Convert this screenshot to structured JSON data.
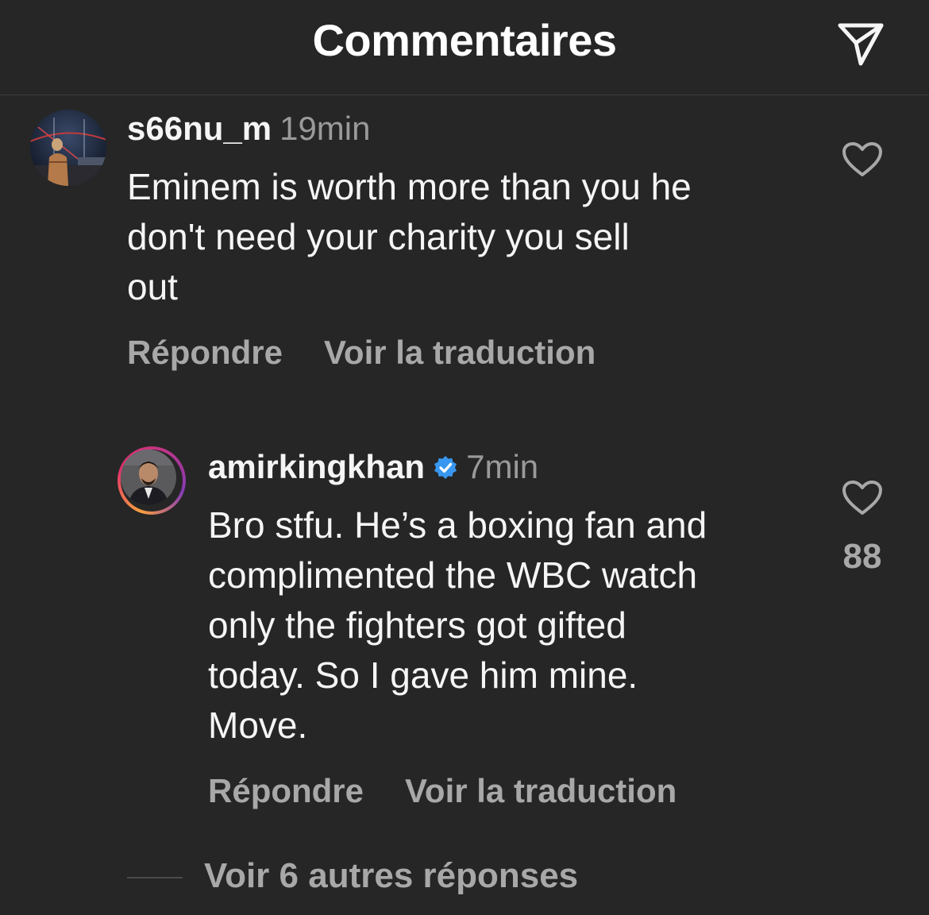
{
  "header": {
    "title": "Commentaires",
    "share_icon": "paper-plane-icon"
  },
  "comments": [
    {
      "username": "s66nu_m",
      "time": "19min",
      "verified": false,
      "text": "Eminem is worth more than you he\ndon't need your charity you sell\nout",
      "reply_label": "Répondre",
      "translate_label": "Voir la traduction",
      "like_icon": "heart-outline-icon"
    },
    {
      "username": "amirkingkhan",
      "time": "7min",
      "verified": true,
      "text": "Bro stfu. He’s a boxing fan and\ncomplimented the WBC watch\nonly the fighters got gifted\ntoday. So I gave him mine.\nMove.",
      "reply_label": "Répondre",
      "translate_label": "Voir la traduction",
      "like_icon": "heart-outline-icon",
      "like_count": "88"
    }
  ],
  "more_replies_label": "Voir 6 autres réponses",
  "colors": {
    "background": "#262626",
    "text_primary": "#f5f5f5",
    "text_secondary": "#a8a8a8",
    "verified_blue": "#3897f0"
  }
}
